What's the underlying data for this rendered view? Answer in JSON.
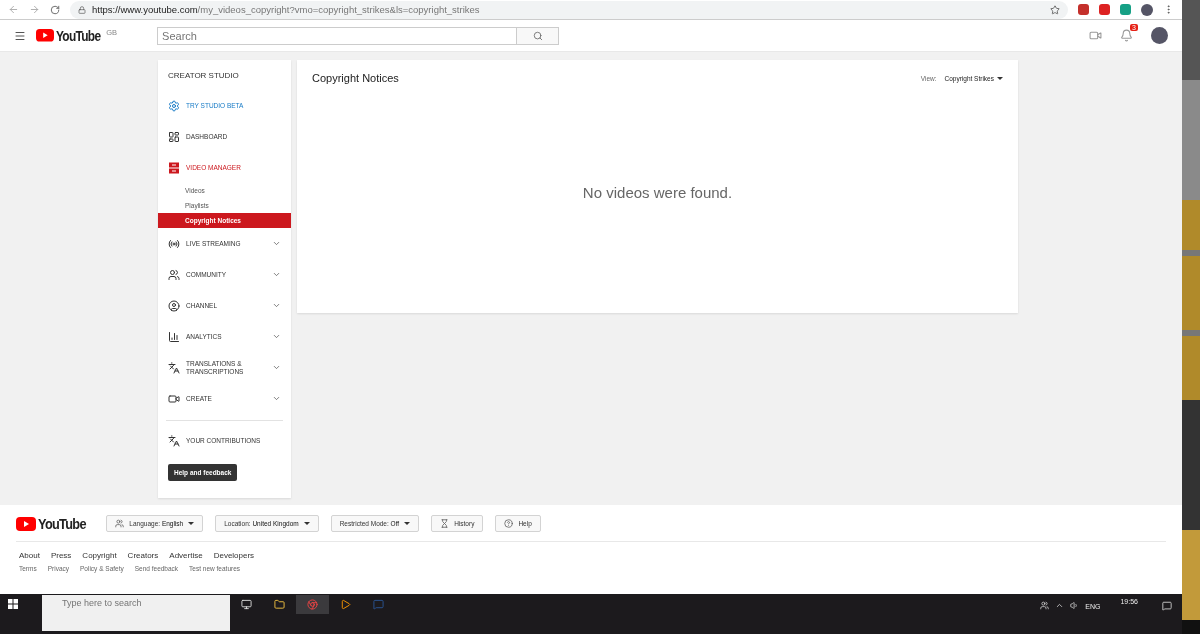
{
  "browser": {
    "url_host": "https://www.youtube.com",
    "url_path": "/my_videos_copyright?vmo=copyright_strikes&ls=copyright_strikes"
  },
  "header": {
    "logo": "YouTube",
    "region": "GB",
    "search": {
      "placeholder": "Search"
    },
    "notification_count": "3"
  },
  "sidebar": {
    "title": "CREATOR STUDIO",
    "items": [
      {
        "label": "TRY STUDIO BETA",
        "kind": "promo",
        "selected": false
      },
      {
        "label": "DASHBOARD",
        "kind": "link",
        "selected": false
      },
      {
        "label": "VIDEO MANAGER",
        "kind": "link",
        "selected": true,
        "children": [
          {
            "label": "Videos",
            "selected": false
          },
          {
            "label": "Playlists",
            "selected": false
          },
          {
            "label": "Copyright Notices",
            "selected": true
          }
        ]
      },
      {
        "label": "LIVE STREAMING",
        "kind": "expandable",
        "selected": false
      },
      {
        "label": "COMMUNITY",
        "kind": "expandable",
        "selected": false
      },
      {
        "label": "CHANNEL",
        "kind": "expandable",
        "selected": false
      },
      {
        "label": "ANALYTICS",
        "kind": "expandable",
        "selected": false
      },
      {
        "label": "TRANSLATIONS & TRANSCRIPTIONS",
        "kind": "expandable",
        "selected": false
      },
      {
        "label": "CREATE",
        "kind": "expandable",
        "selected": false
      },
      {
        "label": "YOUR CONTRIBUTIONS",
        "kind": "link",
        "selected": false
      }
    ],
    "help_button": "Help and feedback"
  },
  "content": {
    "title": "Copyright Notices",
    "view_label": "View:",
    "view_value": "Copyright Strikes",
    "empty_message": "No videos were found."
  },
  "footer": {
    "logo": "YouTube",
    "buttons": [
      {
        "label": "Language: ",
        "value": "English",
        "kind": "dropdown"
      },
      {
        "label": "Location: ",
        "value": "United Kingdom",
        "kind": "dropdown"
      },
      {
        "label": "Restricted Mode: ",
        "value": "Off",
        "kind": "dropdown"
      },
      {
        "label": "History",
        "kind": "plain"
      },
      {
        "label": "Help",
        "kind": "plain"
      }
    ],
    "links": [
      "About",
      "Press",
      "Copyright",
      "Creators",
      "Advertise",
      "Developers"
    ],
    "sublinks": [
      "Terms",
      "Privacy",
      "Policy & Safety",
      "Send feedback",
      "Test new features"
    ]
  },
  "taskbar": {
    "search": {
      "placeholder": "Type here to search"
    },
    "language": "ENG",
    "time": "19:56"
  }
}
